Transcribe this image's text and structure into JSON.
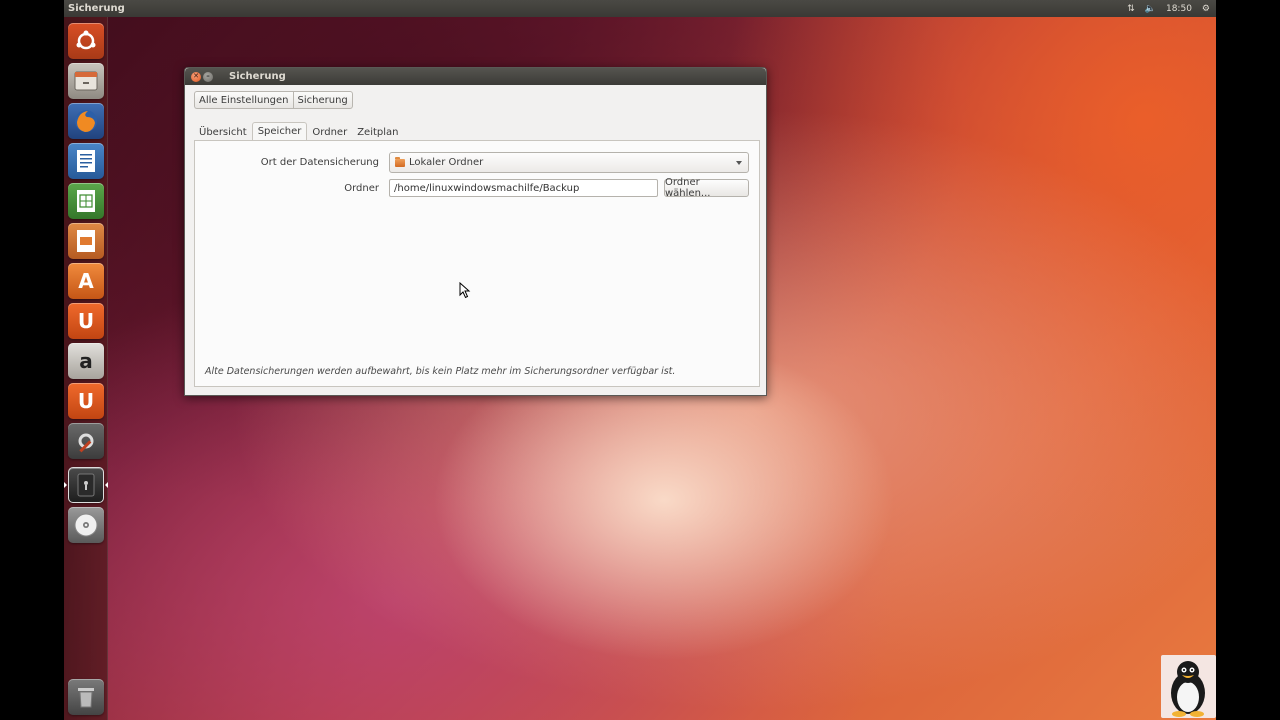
{
  "top_panel": {
    "app_title": "Sicherung",
    "clock": "18:50",
    "network_icon": "network-arrows-icon",
    "volume_icon": "volume-icon",
    "session_icon": "gear-icon"
  },
  "launcher": {
    "items": [
      {
        "name": "ubuntu-dash",
        "icon": "ubuntu-logo-icon"
      },
      {
        "name": "files",
        "icon": "file-cabinet-icon"
      },
      {
        "name": "firefox",
        "icon": "firefox-icon"
      },
      {
        "name": "libreoffice-writer",
        "icon": "writer-icon"
      },
      {
        "name": "libreoffice-calc",
        "icon": "calc-icon"
      },
      {
        "name": "libreoffice-impress",
        "icon": "impress-icon"
      },
      {
        "name": "software-center",
        "icon": "shopping-bag-icon",
        "glyph": "A"
      },
      {
        "name": "ubuntu-one",
        "icon": "ubuntu-one-icon",
        "glyph": "U"
      },
      {
        "name": "amazon",
        "icon": "amazon-icon",
        "glyph": "a"
      },
      {
        "name": "ubuntu-one-music",
        "icon": "ubuntu-one-icon",
        "glyph": "U"
      },
      {
        "name": "system-settings",
        "icon": "settings-icon"
      },
      {
        "name": "backup",
        "icon": "safe-icon"
      },
      {
        "name": "dvd",
        "icon": "disc-icon"
      },
      {
        "name": "trash",
        "icon": "trash-icon"
      }
    ]
  },
  "window": {
    "title": "Sicherung",
    "breadcrumb": [
      "Alle Einstellungen",
      "Sicherung"
    ],
    "tabs": [
      {
        "label": "Übersicht",
        "active": false
      },
      {
        "label": "Speicher",
        "active": true
      },
      {
        "label": "Ordner",
        "active": false
      },
      {
        "label": "Zeitplan",
        "active": false
      }
    ],
    "storage": {
      "location_label": "Ort der Datensicherung",
      "location_value": "Lokaler Ordner",
      "folder_label": "Ordner",
      "folder_value": "/home/linuxwindowsmachilfe/Backup",
      "choose_button": "Ordner wählen...",
      "note": "Alte Datensicherungen werden aufbewahrt, bis kein Platz mehr im Sicherungsordner verfügbar ist."
    }
  },
  "colors": {
    "accent": "#dd4814",
    "panel": "#3c3b37"
  }
}
